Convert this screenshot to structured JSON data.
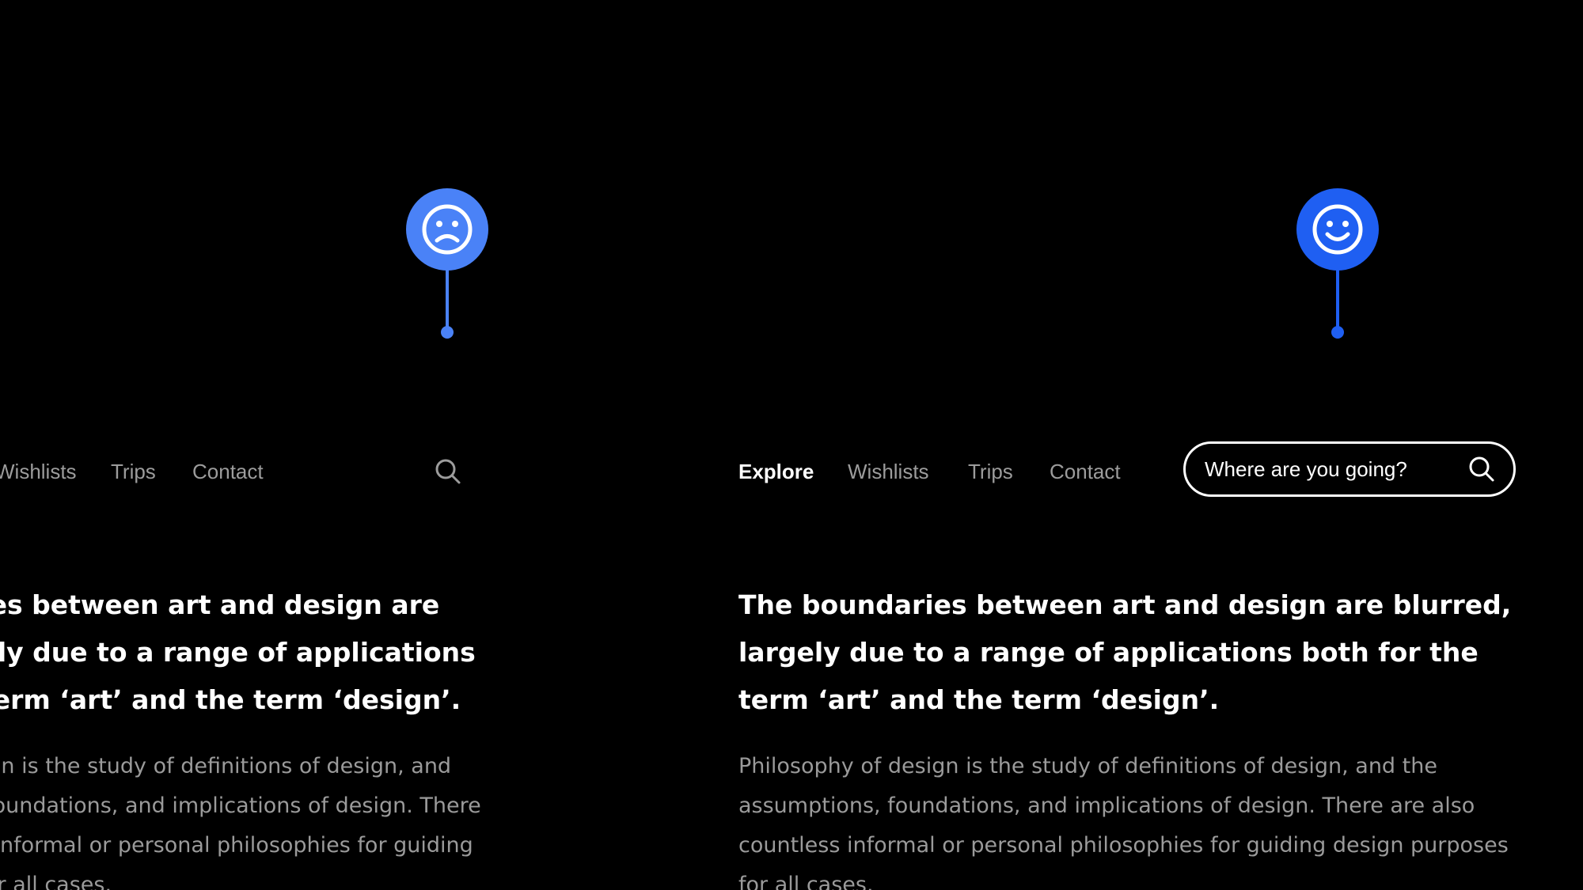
{
  "left": {
    "mood": "sad",
    "nav": {
      "wishlists": "Wishlists",
      "trips": "Trips",
      "contact": "Contact"
    },
    "headline": "The boundaries between art and design are blurred, largely due to a range of applications both for the term ‘art’ and the term ‘design’.",
    "body": "Philosophy of design is the study of definitions of design, and the assumptions, foundations, and implications of design. There are also countless informal or personal philosophies for guiding design purposes for all cases."
  },
  "right": {
    "mood": "happy",
    "nav": {
      "explore": "Explore",
      "wishlists": "Wishlists",
      "trips": "Trips",
      "contact": "Contact"
    },
    "search": {
      "placeholder": "Where are you going?"
    },
    "headline": "The boundaries between art and design are blurred, largely due to a range of applications both for the term ‘art’ and the term ‘design’.",
    "body": "Philosophy of design is the study of definitions of design, and the assumptions, foundations, and implications of design. There are also countless informal or personal philosophies for guiding design purposes for all cases."
  },
  "colors": {
    "background": "#000000",
    "pin_sad": "#4a82f7",
    "pin_happy": "#1f5ff2",
    "nav_inactive": "#9c9c9c",
    "body_text": "#9a9a9a"
  },
  "icons": {
    "sad": "sad-face-icon",
    "happy": "happy-face-icon",
    "search": "search-icon"
  }
}
